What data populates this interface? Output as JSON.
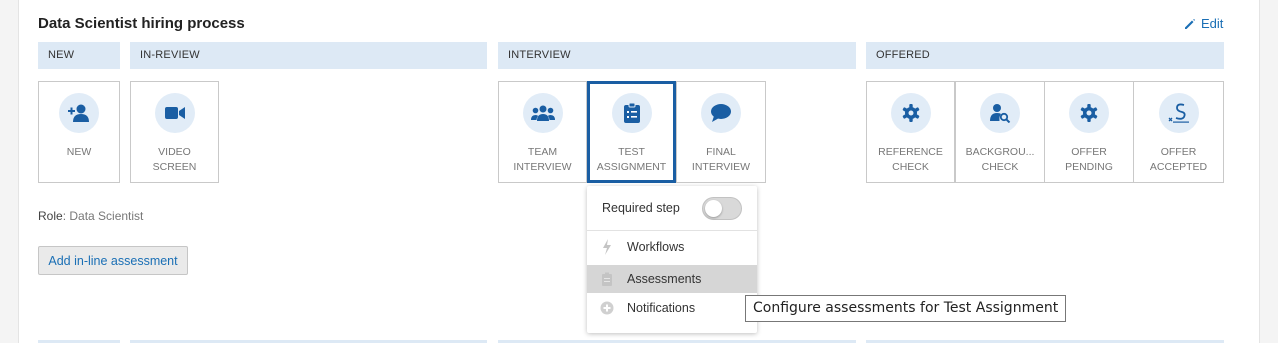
{
  "page": {
    "title": "Data Scientist hiring process",
    "edit_label": "Edit"
  },
  "stages": {
    "new": "NEW",
    "in_review": "IN-REVIEW",
    "interview": "INTERVIEW",
    "offered": "OFFERED"
  },
  "steps": [
    {
      "label": "NEW",
      "icon": "add-person-icon"
    },
    {
      "label": "VIDEO\nSCREEN",
      "icon": "video-camera-icon"
    },
    {
      "label": "TEAM\nINTERVIEW",
      "icon": "team-icon"
    },
    {
      "label": "TEST\nASSIGNMENT",
      "icon": "clipboard-list-icon",
      "selected": true
    },
    {
      "label": "FINAL\nINTERVIEW",
      "icon": "chat-bubble-icon"
    },
    {
      "label": "REFERENCE\nCHECK",
      "icon": "gear-icon"
    },
    {
      "label": "BACKGROU...\nCHECK",
      "icon": "person-search-icon"
    },
    {
      "label": "OFFER\nPENDING",
      "icon": "gear-icon"
    },
    {
      "label": "OFFER\nACCEPTED",
      "icon": "signature-icon"
    }
  ],
  "role": {
    "label": "Role",
    "value": ": Data Scientist"
  },
  "add_assessment_label": "Add in-line assessment",
  "menu": {
    "required_step_label": "Required step",
    "required_step_on": false,
    "items": [
      {
        "label": "Workflows",
        "icon": "lightning-icon"
      },
      {
        "label": "Assessments",
        "icon": "clipboard-icon",
        "active": true
      },
      {
        "label": "Notifications",
        "icon": "plus-circle-icon"
      }
    ]
  },
  "tooltip": "Configure assessments for Test Assignment",
  "colors": {
    "accent": "#1a5ea3",
    "link": "#1a6fb5",
    "stage_header": "#dde9f5",
    "icon_circle": "#e1ecf7"
  }
}
